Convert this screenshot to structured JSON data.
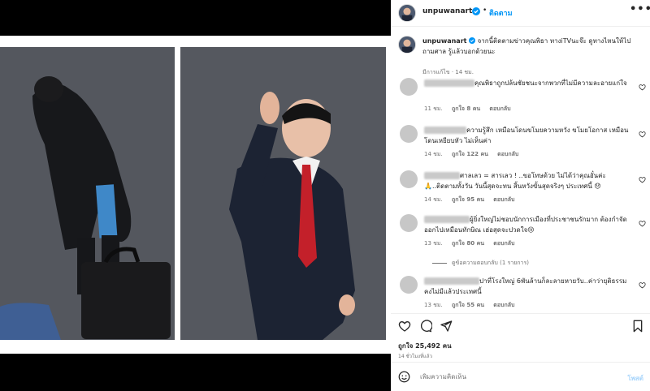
{
  "header": {
    "username": "unpuwanart",
    "follow_label": "ติดตาม",
    "separator": "•",
    "more_label": "•••",
    "verified_icon": "verified-badge-icon"
  },
  "caption": {
    "username": "unpuwanart",
    "text": "จากนี้ติดตามข่าวคุณพิธา ทางiTVนะจ๊ะ ดูทางไหนให้ไปถามศาล รู้แล้วบอกด้วยนะ",
    "meta": "มีการแก้ไข · 14 ชม."
  },
  "comments": [
    {
      "text": "คุณพิธาถูกปล้นชัยชนะจากพวกที่ไม่มีความละอายแก่ใจ",
      "time": "11 ชม.",
      "likes": "ถูกใจ 8 คน",
      "reply": "ตอบกลับ"
    },
    {
      "text": "ความรู้สึก เหมือนโดนขโมยความหวัง ขโมยโอกาส เหมือนโดนเหยียบหัว ไม่เห็นค่า",
      "time": "14 ชม.",
      "likes": "ถูกใจ 122 คน",
      "reply": "ตอบกลับ"
    },
    {
      "text": "ศาลเลว = สารเลว ! ..ขอโทษด้วย ไม่ได้ว่าคุณอั๋นค่ะ 🙏..ติดตามทั้งวัน วันนี้สุดจะทน สิ้นหวังขั้นสุดจริงๆ ประเทศนี้ 😞",
      "time": "14 ชม.",
      "likes": "ถูกใจ 95 คน",
      "reply": "ตอบกลับ"
    },
    {
      "text": "ผู้ยิ่งใหญ่ไม่ชอบนักการเมืองที่ประชาชนรักมาก ต้องกำจัดออกไปเหมือนทักษิณ เฮ่อสุดจะปวดใจ😢",
      "time": "13 ชม.",
      "likes": "ถูกใจ 80 คน",
      "reply": "ตอบกลับ",
      "view_replies": "ดูข้อความตอบกลับ (1 รายการ)"
    },
    {
      "text": "ปาที่โรงใหญ่ 6พันล้านก็ละลายหายวับ..ค่าว่ายุติธรรมคงไม่มีแล้วประเทศนี้",
      "time": "13 ชม.",
      "likes": "ถูกใจ 55 คน",
      "reply": "ตอบกลับ"
    }
  ],
  "actions": {
    "likes": "ถูกใจ 25,492 คน",
    "time": "14 ชั่วโมงที่แล้ว"
  },
  "add_comment": {
    "placeholder": "เพิ่มความคิดเห็น",
    "post_label": "โพสต์"
  },
  "colors": {
    "accent": "#0095f6",
    "muted": "#737373"
  }
}
